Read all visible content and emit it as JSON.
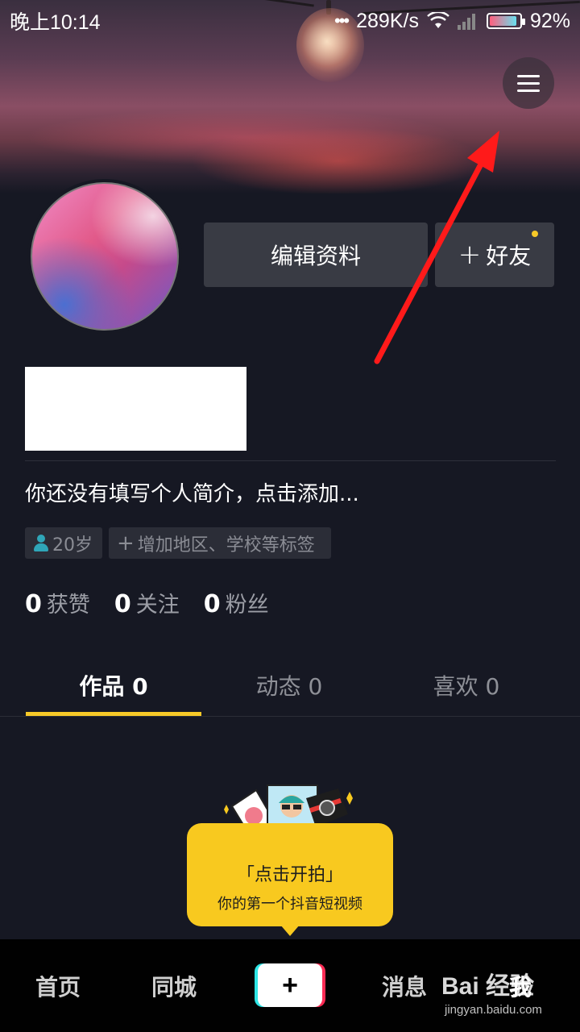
{
  "status_bar": {
    "time": "晚上10:14",
    "network_speed": "289K/s",
    "battery": "92%",
    "battery_level": 0.92
  },
  "profile": {
    "edit_label": "编辑资料",
    "add_friend_label": "好友",
    "bio": "你还没有填写个人简介，点击添加...",
    "tags": {
      "age": "20岁",
      "add_tags": "增加地区、学校等标签"
    },
    "stats": [
      {
        "num": "0",
        "label": "获赞"
      },
      {
        "num": "0",
        "label": "关注"
      },
      {
        "num": "0",
        "label": "粉丝"
      }
    ]
  },
  "tabs": [
    {
      "label": "作品 0",
      "active": true
    },
    {
      "label": "动态 0",
      "active": false
    },
    {
      "label": "喜欢 0",
      "active": false
    }
  ],
  "prompt_card": {
    "title": "「点击开拍」",
    "subtitle": "你的第一个抖音短视频"
  },
  "bottom_nav": {
    "home": "首页",
    "nearby": "同城",
    "create": "+",
    "messages": "消息",
    "me": "我"
  },
  "watermark": {
    "text": "Bai 经验",
    "url": "jingyan.baidu.com"
  },
  "colors": {
    "background": "#161823",
    "accent_yellow": "#f8c91f",
    "button_bg": "#393b44",
    "annotation_red": "#ff1a1a"
  }
}
